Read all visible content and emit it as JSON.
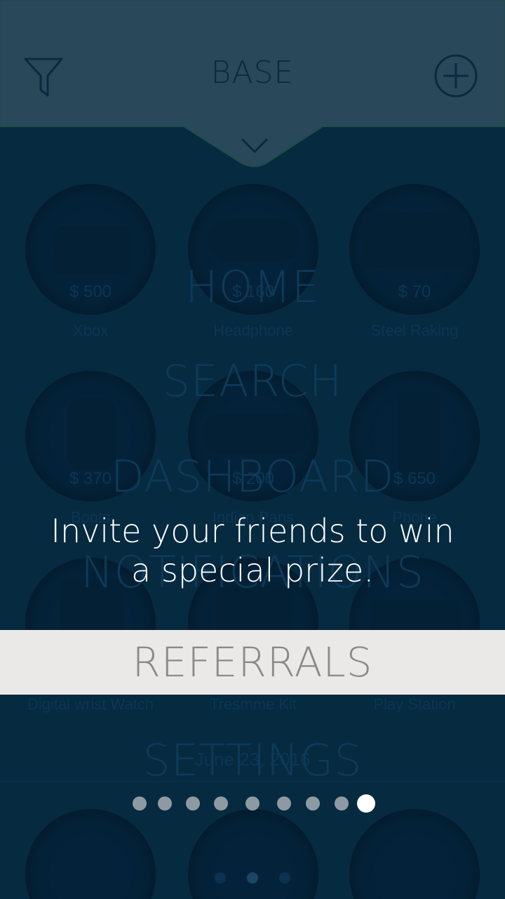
{
  "header": {
    "title": "BASE",
    "left_icon": "filter-icon",
    "right_icon": "add-circle-icon",
    "chevron_icon": "chevron-down-icon"
  },
  "products": [
    {
      "name": "Xbox",
      "price": "$ 500"
    },
    {
      "name": "Headphone",
      "price": "$ 160"
    },
    {
      "name": "Steel Raking",
      "price": "$ 70"
    },
    {
      "name": "Boots",
      "price": "$ 370"
    },
    {
      "name": "Indian Pans",
      "price": "$ 200"
    },
    {
      "name": "Phone",
      "price": "$ 650"
    },
    {
      "name": "Digital wrist Watch",
      "price": ""
    },
    {
      "name": "Tresmme Kit",
      "price": ""
    },
    {
      "name": "Play Station",
      "price": ""
    }
  ],
  "date_label": "June 23, 2016",
  "menu": {
    "home": "HOME",
    "search": "SEARCH",
    "dashboard": "DASHBOARD",
    "notifications": "NOTIFICATIONS",
    "referrals": "REFERRALS",
    "settings": "SETTINGS"
  },
  "onboarding": {
    "message": "Invite your friends to win a special prize.",
    "page_count": 9,
    "active_page": 9
  },
  "colors": {
    "background": "#062a40",
    "header": "#29485a",
    "highlight_band": "#ebe9e7",
    "dot_inactive": "#8e9aa3",
    "dot_active": "#ffffff"
  }
}
